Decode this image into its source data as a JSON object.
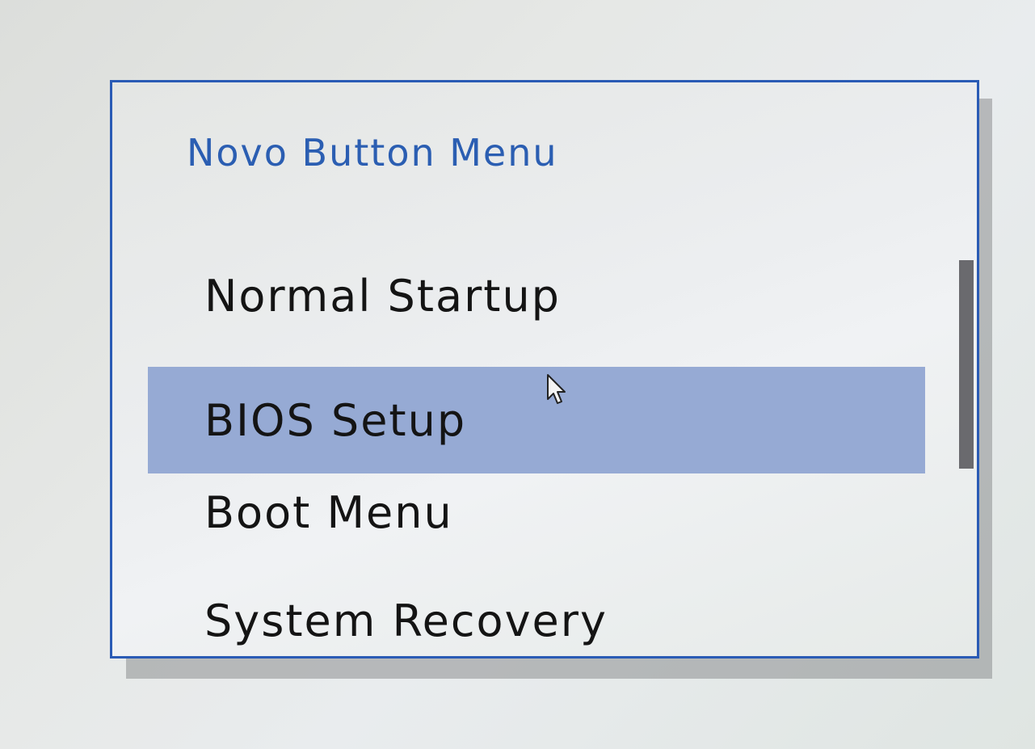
{
  "menu": {
    "title": "Novo Button Menu",
    "selected_index": 1,
    "items": [
      {
        "label": "Normal Startup"
      },
      {
        "label": "BIOS Setup"
      },
      {
        "label": "Boot Menu"
      },
      {
        "label": "System Recovery"
      }
    ]
  },
  "colors": {
    "border": "#2a5bb5",
    "title_text": "#2b5eb2",
    "selection_highlight": "#96aad4",
    "item_text": "#141414",
    "scrollbar_thumb": "#6a6a6e"
  },
  "icons": {
    "cursor": "mouse-pointer-icon"
  }
}
